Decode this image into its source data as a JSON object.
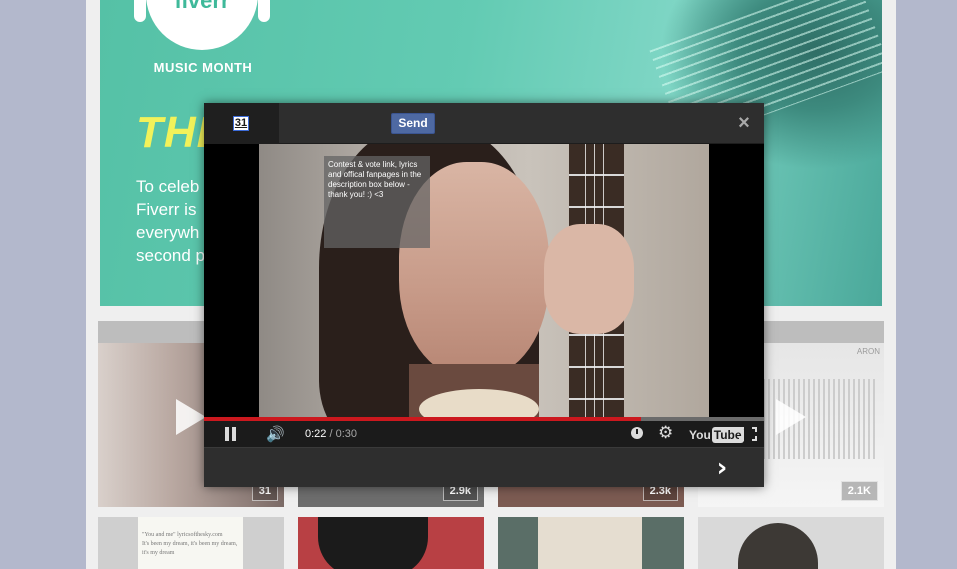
{
  "banner": {
    "logo_text": "fiverr",
    "subtitle": "MUSIC MONTH",
    "headline": "THE",
    "copy": "To celeb\nFiverr is\neverywh\nsecond p"
  },
  "thumbnails": [
    {
      "count": "31"
    },
    {
      "count": "2.9k"
    },
    {
      "count": "2.3k"
    },
    {
      "count": "2.1K",
      "watermark": "ARON"
    }
  ],
  "lower_thumbnail_note": "\"You and me\" lyricsofthesky.com\nIt's been my dream, it's been my dream,\nit's my dream",
  "dialog": {
    "vote_count": "31",
    "send_label": "Send",
    "close_symbol": "×",
    "next_symbol": "›",
    "video": {
      "annotation": "Contest & vote link, lyrics and offical fanpages in the description box below - thank you! :) <3",
      "current_time": "0:22",
      "separator": " / ",
      "duration": "0:30",
      "progress": 0.78,
      "logo_you": "You",
      "logo_tube": "Tube"
    }
  },
  "colors": {
    "send_button": "#4e69a2",
    "progress_red": "#cc181e",
    "banner_green": "#5fc6ae",
    "headline_yellow": "#f2f25a"
  },
  "icons": {
    "pause": "pause-icon",
    "volume": "volume-icon",
    "watch_later": "clock-icon",
    "settings": "gear-icon",
    "fullscreen": "fullscreen-icon",
    "close": "close-icon",
    "next": "chevron-right-icon",
    "play": "play-icon"
  }
}
